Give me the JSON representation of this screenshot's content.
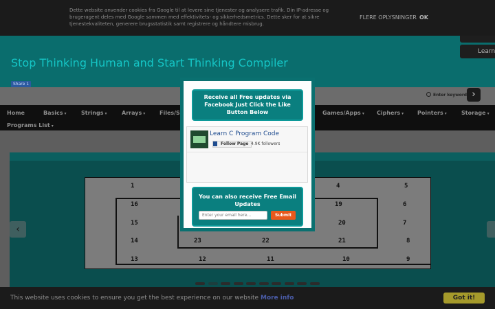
{
  "cookie_top": {
    "text": "Dette website anvender cookies fra Google til at levere sine tjenester og analysere trafik. Din IP-adresse og brugeragent deles med Google sammen med effektivitets- og sikkerhedsmetrics. Dette sker for at sikre tjenestekvaliteten, generere brugsstatistik samt registrere og håndtere misbrug.",
    "more_label": "FLERE OPLYSNINGER",
    "ok_label": "OK"
  },
  "header": {
    "site_title": "Stop Thinking Human and Start Thinking Compiler",
    "fb_share": "Share 1",
    "top_button_2": "Learn"
  },
  "search": {
    "placeholder": "Enter keyword"
  },
  "nav": {
    "items": [
      {
        "label": "Home"
      },
      {
        "label": "Basics"
      },
      {
        "label": "Strings"
      },
      {
        "label": "Arrays"
      },
      {
        "label": "Files/St"
      },
      {
        "label": "Games/Apps"
      },
      {
        "label": "Ciphers"
      },
      {
        "label": "Pointers"
      },
      {
        "label": "Storage"
      },
      {
        "label": "Programs List"
      }
    ],
    "caret": "▾"
  },
  "slide": {
    "numbers": [
      "1",
      "4",
      "5",
      "16",
      "19",
      "6",
      "15",
      "20",
      "7",
      "14",
      "23",
      "22",
      "21",
      "8",
      "13",
      "12",
      "11",
      "10",
      "9"
    ],
    "dots_count": 10,
    "active_dot": 1
  },
  "modal": {
    "heading": "Receive all Free updates via Facebook Just Click the Like Button Below",
    "fb_page_name": "Learn C Program Code",
    "fb_follow": "Follow Page",
    "fb_followers": "4.9K followers",
    "email_heading": "You can also receive Free Email Updates",
    "email_placeholder": "Enter your email here...",
    "submit_label": "Submit"
  },
  "cookie_bottom": {
    "text": "This website uses cookies to ensure you get the best experience on our website",
    "more_info": "More info",
    "got_it": "Got it!"
  }
}
